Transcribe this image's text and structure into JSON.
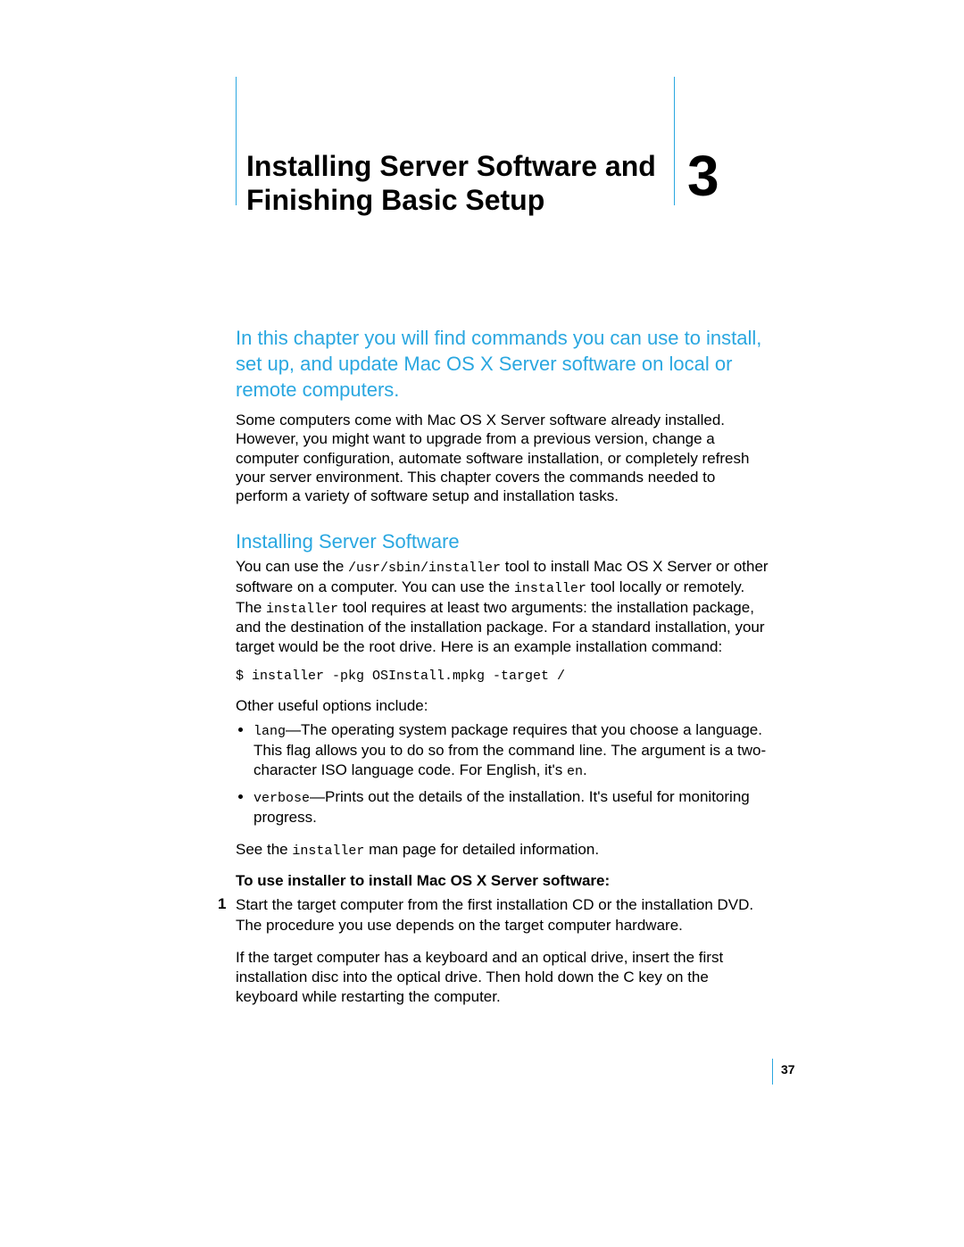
{
  "chapter": {
    "number": "3",
    "title": "Installing Server Software and Finishing Basic Setup"
  },
  "intro": "In this chapter you will find commands you can use to install, set up, and update Mac OS X Server software on local or remote computers.",
  "para_overview": "Some computers come with Mac OS X Server software already installed. However, you might want to upgrade from a previous version, change a computer configuration, automate software installation, or completely refresh your server environment. This chapter covers the commands needed to perform a variety of software setup and installation tasks.",
  "section_heading": "Installing Server Software",
  "para_tool": {
    "pre1": "You can use the ",
    "code1": "/usr/sbin/installer",
    "mid1": " tool to install Mac OS X Server or other software on a computer. You can use the ",
    "code2": "installer",
    "mid2": " tool locally or remotely. The ",
    "code3": "installer",
    "post": " tool requires at least two arguments: the installation package, and the destination of the installation package. For a standard installation, your target would be the root drive. Here is an example installation command:"
  },
  "example_cmd": "$ installer -pkg OSInstall.mpkg -target /",
  "para_options_lead": "Other useful options include:",
  "options": {
    "lang": {
      "code": "lang",
      "text_mid": "—The operating system package requires that you choose a language. This flag allows you to do so from the command line. The argument is a two-character ISO language code. For English, it's ",
      "code_tail": "en",
      "text_tail": "."
    },
    "verbose": {
      "code": "verbose",
      "text": "—Prints out the details of the installation. It's useful for monitoring progress."
    }
  },
  "para_see": {
    "pre": "See the ",
    "code": "installer",
    "post": " man page for detailed information."
  },
  "howto_heading": "To use installer to install Mac OS X Server software:",
  "steps": {
    "n1": "1",
    "s1": "Start the target computer from the first installation CD or the installation DVD. The procedure you use depends on the target computer hardware.",
    "s1b": "If the target computer has a keyboard and an optical drive, insert the first installation disc into the optical drive. Then hold down the C key on the keyboard while restarting the computer."
  },
  "page_number": "37"
}
